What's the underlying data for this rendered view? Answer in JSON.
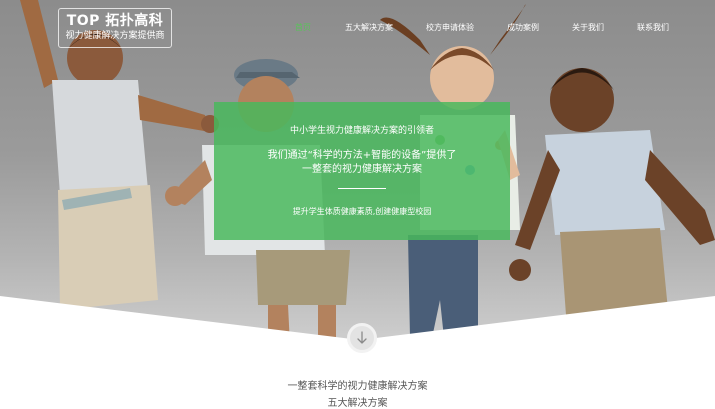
{
  "logo": {
    "title": "TOP 拓扑高科",
    "subtitle": "视力健康解决方案提供商"
  },
  "nav": {
    "items": [
      {
        "label": "首页",
        "active": true
      },
      {
        "label": "五大解决方案",
        "active": false
      },
      {
        "label": "校方申请体验",
        "active": false
      },
      {
        "label": "成功案例",
        "active": false
      },
      {
        "label": "关于我们",
        "active": false
      },
      {
        "label": "联系我们",
        "active": false
      }
    ]
  },
  "hero": {
    "line1": "中小学生视力健康解决方案的引领者",
    "line2a": "我们通过“科学的方法+智能的设备”提供了",
    "line2b": "一整套的视力健康解决方案",
    "line3": "提升学生体质健康素质,创建健康型校园",
    "box_color": "#48b95c"
  },
  "scroll_button": {
    "icon": "arrow-down-icon"
  },
  "section": {
    "intro": "一整套科学的视力健康解决方案",
    "title": "五大解决方案"
  },
  "colors": {
    "accent": "#5ac25a",
    "text": "#555555"
  }
}
